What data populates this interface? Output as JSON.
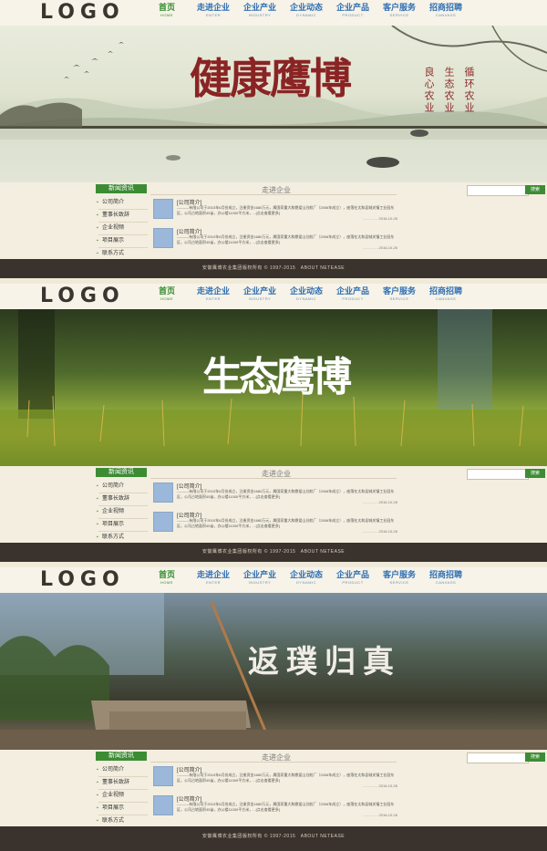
{
  "logo": "LOGO",
  "nav": [
    {
      "cn": "首页",
      "en": "HOME",
      "active": true
    },
    {
      "cn": "走进企业",
      "en": "ENTER"
    },
    {
      "cn": "企业产业",
      "en": "INDUSTRY"
    },
    {
      "cn": "企业动态",
      "en": "DYNAMIC"
    },
    {
      "cn": "企业产品",
      "en": "PRODUCT"
    },
    {
      "cn": "客户服务",
      "en": "SERVICE"
    },
    {
      "cn": "招商招聘",
      "en": "CANVASS"
    }
  ],
  "banners": [
    {
      "title": "健康鹰博",
      "slogans": [
        "良心农业",
        "生态农业",
        "循环农业"
      ]
    },
    {
      "title": "生态鹰博"
    },
    {
      "title": "返璞归真"
    }
  ],
  "sidebar": {
    "heading": "新闻资讯",
    "items": [
      "公司简介",
      "董事长致辞",
      "企业视频",
      "项目展示",
      "联系方式"
    ]
  },
  "section_title": "走进企业",
  "search": {
    "placeholder": "",
    "button": "搜索"
  },
  "news": [
    {
      "title": "[公司简介]",
      "desc": "----------有限公司于2010年6月份成立，注册资金1680万元，属国家重大和鼎爱山谷航厂（2006年成立），座落在太和县城关镇工业园东区，公司占地面积45亩，办公楼11000平方米，...[点击查看更多]",
      "date": "- - - - - - - 2016-10-26"
    },
    {
      "title": "[公司简介]",
      "desc": "----------有限公司于2010年6月份成立，注册资金1680万元，属国家重大和鼎爱山谷航厂（2006年成立），座落在太和县城关镇工业园东区，公司占地面积45亩，办公楼11000平方米，...[点击查看更多]",
      "date": "- - - - - - - 2016-10-26"
    }
  ],
  "footer": "安徽鹰博农业集团版权所有 © 1997-2015　ABOUT NETEASE",
  "colors": {
    "green": "#3c8c34",
    "nav_blue": "#2f6fb3",
    "footer_bg": "#3a322c"
  }
}
